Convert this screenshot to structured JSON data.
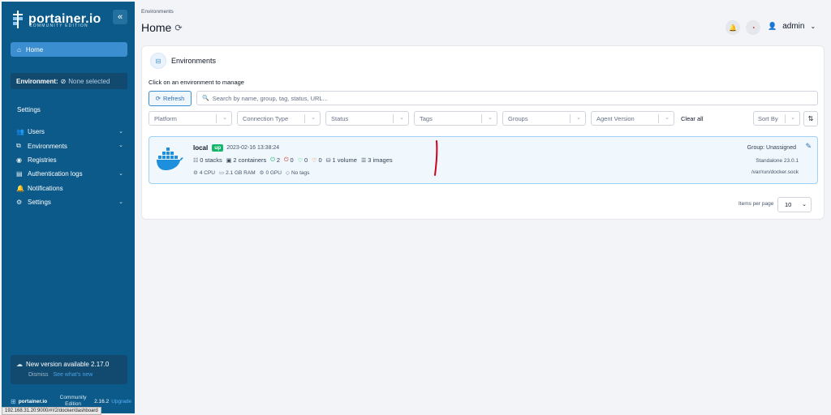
{
  "sidebar": {
    "logo": "portainer.io",
    "logo_sub": "COMMUNITY EDITION",
    "collapse_icon": "«",
    "home": "Home",
    "environment_label": "Environment:",
    "environment_value": "None selected",
    "settings_title": "Settings",
    "items": [
      {
        "label": "Users",
        "icon": "users-icon",
        "chevron": true
      },
      {
        "label": "Environments",
        "icon": "environments-icon",
        "chevron": true
      },
      {
        "label": "Registries",
        "icon": "registries-icon",
        "chevron": false
      },
      {
        "label": "Authentication logs",
        "icon": "auth-logs-icon",
        "chevron": true
      },
      {
        "label": "Notifications",
        "icon": "bell-icon",
        "chevron": false
      },
      {
        "label": "Settings",
        "icon": "gear-icon",
        "chevron": true
      }
    ],
    "update": {
      "title": "New version available 2.17.0",
      "dismiss": "Dismiss",
      "whats_new": "See what's new"
    },
    "footer": {
      "brand": "portainer.io",
      "edition": "Community Edition",
      "version": "2.16.2",
      "upgrade": "Upgrade"
    }
  },
  "status_url": "192.168.31.20:9000/#!/2/docker/dashboard",
  "header": {
    "breadcrumb": "Environments",
    "title": "Home",
    "user": "admin"
  },
  "panel": {
    "title": "Environments",
    "hint": "Click on an environment to manage",
    "refresh": "Refresh",
    "search_placeholder": "Search by name, group, tag, status, URL...",
    "filters": [
      "Platform",
      "Connection Type",
      "Status",
      "Tags",
      "Groups",
      "Agent Version"
    ],
    "clear_all": "Clear all",
    "sort_by": "Sort By",
    "items_per_page_label": "Items per page",
    "items_per_page": "10"
  },
  "environment": {
    "name": "local",
    "status": "up",
    "timestamp": "2023-02-16 13:38:24",
    "stacks": "0 stacks",
    "containers": "2 containers",
    "running": "2",
    "stopped": "0",
    "healthy": "0",
    "unhealthy": "0",
    "volumes": "1 volume",
    "images": "3 images",
    "cpu": "4 CPU",
    "ram": "2.1 GB RAM",
    "gpu": "0 GPU",
    "tags": "No tags",
    "group": "Group: Unassigned",
    "type": "Standalone 23.0.1",
    "url": "/var/run/docker.sock"
  },
  "colors": {
    "sidebar_bg": "#0b5a8a",
    "accent": "#3b8fd0",
    "up_badge": "#12b76a",
    "annotation": "#d0021b"
  }
}
